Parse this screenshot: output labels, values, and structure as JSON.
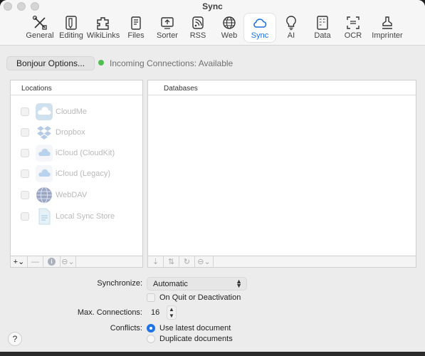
{
  "window": {
    "title": "Sync"
  },
  "toolbar": {
    "items": [
      {
        "label": "General",
        "icon": "general-icon"
      },
      {
        "label": "Editing",
        "icon": "editing-icon"
      },
      {
        "label": "WikiLinks",
        "icon": "wikilinks-icon"
      },
      {
        "label": "Files",
        "icon": "files-icon"
      },
      {
        "label": "Sorter",
        "icon": "sorter-icon"
      },
      {
        "label": "RSS",
        "icon": "rss-icon"
      },
      {
        "label": "Web",
        "icon": "web-icon"
      },
      {
        "label": "Sync",
        "icon": "sync-cloud-icon",
        "active": true
      },
      {
        "label": "AI",
        "icon": "ai-bulb-icon"
      },
      {
        "label": "Data",
        "icon": "data-icon"
      },
      {
        "label": "OCR",
        "icon": "ocr-icon"
      },
      {
        "label": "Imprinter",
        "icon": "imprinter-icon"
      }
    ],
    "active_color": "#1a6fe0"
  },
  "bonjour": {
    "button_label": "Bonjour Options...",
    "status_text": "Incoming Connections: Available",
    "status_color": "#4fc04f"
  },
  "locations": {
    "header": "Locations",
    "items": [
      {
        "label": "CloudMe",
        "icon": "cloudme-icon"
      },
      {
        "label": "Dropbox",
        "icon": "dropbox-icon"
      },
      {
        "label": "iCloud (CloudKit)",
        "icon": "icloud-cloudkit-icon"
      },
      {
        "label": "iCloud (Legacy)",
        "icon": "icloud-legacy-icon"
      },
      {
        "label": "WebDAV",
        "icon": "webdav-icon"
      },
      {
        "label": "Local Sync Store",
        "icon": "local-sync-store-icon"
      }
    ],
    "footer": {
      "add": "+",
      "add_menu": "⌄",
      "remove": "—",
      "info": "i",
      "more": "⊖⌄"
    }
  },
  "databases": {
    "header": "Databases",
    "footer": {
      "import": "⇣",
      "sync": "⇅",
      "refresh": "↻",
      "more": "⊖⌄"
    }
  },
  "settings": {
    "synchronize_label": "Synchronize:",
    "synchronize_value": "Automatic",
    "quit_label": "On Quit or Deactivation",
    "max_label": "Max. Connections:",
    "max_value": "16",
    "conflicts_label": "Conflicts:",
    "conflict_options": [
      "Use latest document",
      "Duplicate documents"
    ],
    "conflict_selected": 0
  },
  "help": {
    "label": "?"
  }
}
